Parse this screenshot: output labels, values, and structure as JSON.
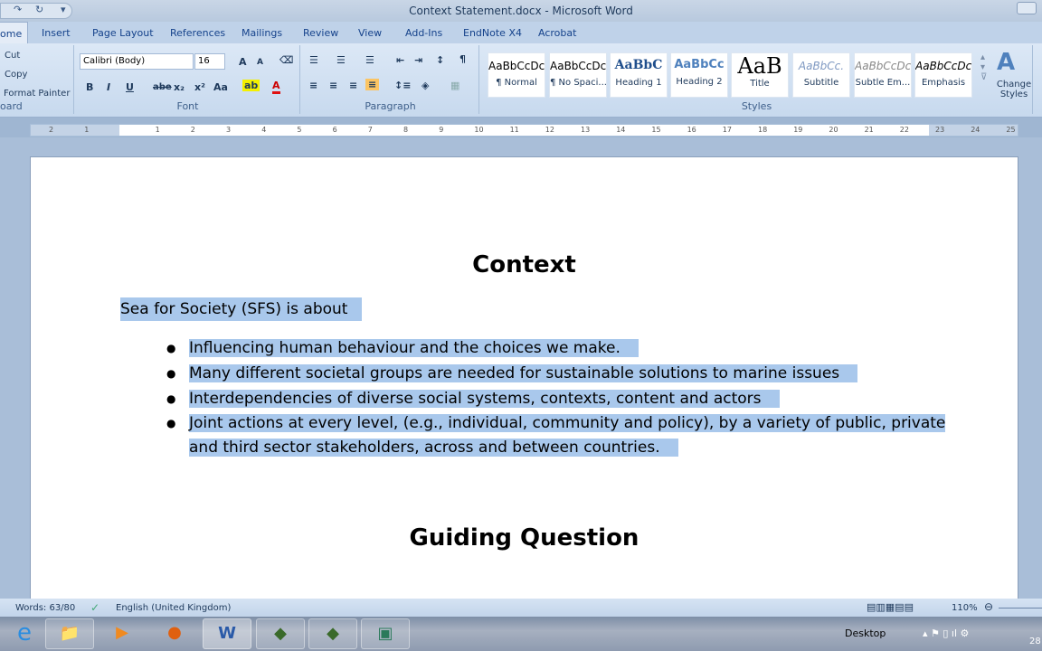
{
  "window": {
    "title": "Context Statement.docx - Microsoft Word"
  },
  "tabs": [
    "ome",
    "Insert",
    "Page Layout",
    "References",
    "Mailings",
    "Review",
    "View",
    "Add-Ins",
    "EndNote X4",
    "Acrobat"
  ],
  "clipboard": {
    "cut": "Cut",
    "copy": "Copy",
    "format_painter": "Format Painter",
    "label": "oard"
  },
  "font": {
    "name": "Calibri (Body)",
    "size": "16",
    "label": "Font",
    "bold": "B",
    "italic": "I",
    "underline": "U",
    "strike": "abe",
    "sub": "x₂",
    "sup": "x²",
    "case": "Aa",
    "grow": "A",
    "shrink": "A"
  },
  "paragraph": {
    "label": "Paragraph",
    "pilcrow": "¶"
  },
  "styles": {
    "label": "Styles",
    "items": [
      {
        "preview": "AaBbCcDc",
        "name": "¶ Normal"
      },
      {
        "preview": "AaBbCcDc",
        "name": "¶ No Spaci..."
      },
      {
        "preview": "AaBbC",
        "name": "Heading 1"
      },
      {
        "preview": "AaBbCc",
        "name": "Heading 2"
      },
      {
        "preview": "AaB",
        "name": "Title"
      },
      {
        "preview": "AaBbCc.",
        "name": "Subtitle"
      },
      {
        "preview": "AaBbCcDc",
        "name": "Subtle Em..."
      },
      {
        "preview": "AaBbCcDc",
        "name": "Emphasis"
      }
    ],
    "change_styles": "Change Styles"
  },
  "ruler": {
    "ticks": [
      "2",
      "1",
      "",
      "1",
      "2",
      "3",
      "4",
      "5",
      "6",
      "7",
      "8",
      "9",
      "10",
      "11",
      "12",
      "13",
      "14",
      "15",
      "16",
      "17",
      "18",
      "19",
      "20",
      "21",
      "22",
      "23",
      "24",
      "25"
    ]
  },
  "document": {
    "heading1": "Context",
    "intro": "Sea for Society (SFS) is about",
    "bullets": [
      "Influencing human behaviour and the choices we make.",
      "Many different societal groups are needed for sustainable solutions to marine issues",
      "Interdependencies of diverse social systems, contexts, content and actors",
      "Joint actions at every level, (e.g., individual, community and policy), by a variety of public, private and third sector stakeholders, across and between countries."
    ],
    "heading2": "Guiding Question"
  },
  "status": {
    "words": "Words: 63/80",
    "language": "English (United Kingdom)",
    "zoom": "110%"
  },
  "taskbar": {
    "desktop": "Desktop",
    "clock": "28"
  },
  "colors": {
    "selection": "#a9c8ec",
    "ribbon": "#dce8f6"
  }
}
